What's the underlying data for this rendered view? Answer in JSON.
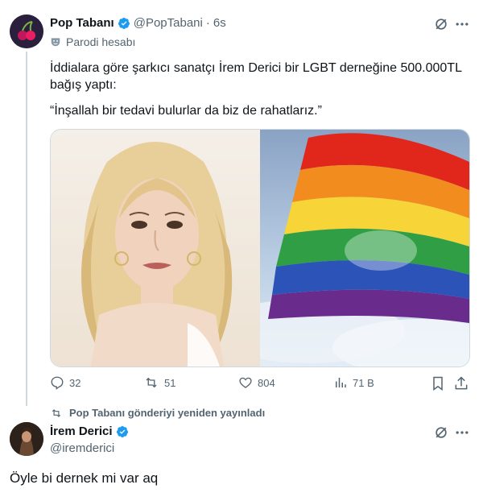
{
  "tweet1": {
    "name": "Pop Tabanı",
    "handle": "@PopTabani",
    "separator": "·",
    "time": "6s",
    "parody_label": "Parodi hesabı",
    "text_line1": "İddialara göre şarkıcı sanatçı İrem Derici bir LGBT derneğine 500.000TL",
    "text_line2": "bağış yaptı:",
    "quote": "“İnşallah bir tedavi bulurlar da biz de rahatlarız.”",
    "stats": {
      "replies": "32",
      "reposts": "51",
      "likes": "804",
      "views": "71 B"
    }
  },
  "repost_banner": "Pop Tabanı gönderiyi yeniden yayınladı",
  "tweet2": {
    "name": "İrem Derici",
    "handle": "@iremderici",
    "text": "Öyle bi dernek mi var aq"
  },
  "colors": {
    "verified": "#1d9bf0",
    "muted": "#536471",
    "text": "#0f1419"
  }
}
